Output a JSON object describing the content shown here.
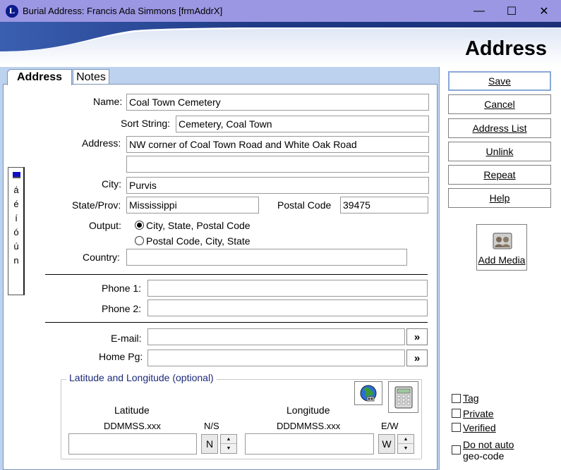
{
  "window": {
    "title": "Burial Address: Francis Ada Simmons [frmAddrX]",
    "app_icon_letter": "L",
    "minimize_glyph": "—",
    "maximize_glyph": "☐",
    "close_glyph": "✕"
  },
  "banner": {
    "title": "Address"
  },
  "tabs": [
    {
      "label": "Address"
    },
    {
      "label": "Notes"
    }
  ],
  "side_tab": {
    "chars": [
      "á",
      "é",
      "í",
      "ó",
      "ú",
      "n"
    ]
  },
  "form": {
    "name": {
      "label": "Name:",
      "value": "Coal Town Cemetery"
    },
    "sort_string": {
      "label": "Sort String:",
      "value": "Cemetery, Coal Town"
    },
    "address": {
      "label": "Address:",
      "line1": "NW corner of Coal Town Road and White Oak Road",
      "line2": ""
    },
    "city": {
      "label": "City:",
      "value": "Purvis"
    },
    "state": {
      "label": "State/Prov:",
      "value": "Mississippi"
    },
    "postal": {
      "label": "Postal Code",
      "value": "39475"
    },
    "output": {
      "label": "Output:",
      "options": [
        "City, State, Postal Code",
        "Postal Code, City, State"
      ],
      "selected": 0
    },
    "country": {
      "label": "Country:",
      "value": ""
    },
    "phone1": {
      "label": "Phone 1:",
      "value": ""
    },
    "phone2": {
      "label": "Phone 2:",
      "value": ""
    },
    "email": {
      "label": "E-mail:",
      "value": ""
    },
    "homepage": {
      "label": "Home Pg:",
      "value": ""
    },
    "go_glyph": "»"
  },
  "latlong": {
    "title": "Latitude and Longitude (optional)",
    "latitude_label": "Latitude",
    "latitude_format": "DDMMSS.xxx",
    "latitude_value": "",
    "ns_label": "N/S",
    "ns_value": "N",
    "longitude_label": "Longitude",
    "longitude_format": "DDDMMSS.xxx",
    "longitude_value": "",
    "ew_label": "E/W",
    "ew_value": "W",
    "spin_up": "▲",
    "spin_down": "▼"
  },
  "buttons": {
    "save": "Save",
    "cancel": "Cancel",
    "address_list": "Address List",
    "unlink": "Unlink",
    "repeat": "Repeat",
    "help": "Help",
    "add_media": "Add Media"
  },
  "checkboxes": {
    "tag": "Tag",
    "private": "Private",
    "verified": "Verified",
    "no_geocode_line1": "Do not auto",
    "no_geocode_line2": "geo-code"
  },
  "colors": {
    "titlebar": "#9b97e2",
    "pane": "#bcd2ee",
    "banner_dark": "#1f3a86",
    "group_title": "#1c2a78"
  }
}
